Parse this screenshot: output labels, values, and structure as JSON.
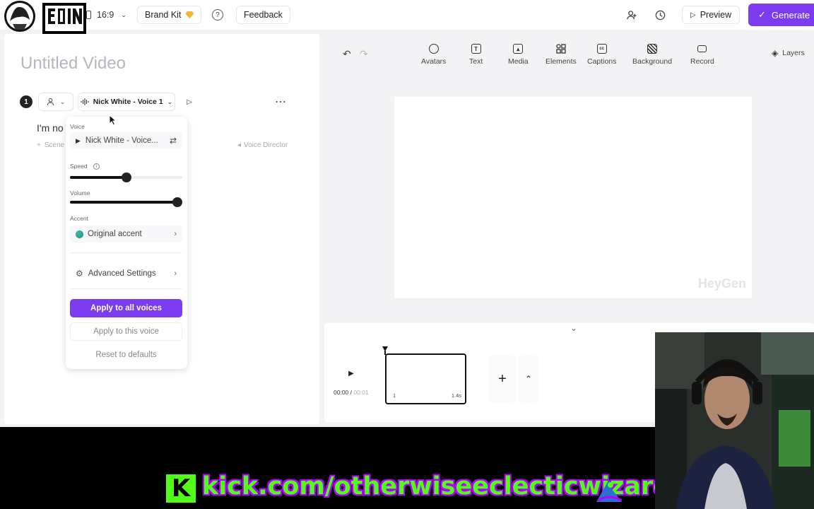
{
  "topbar": {
    "aspect_ratio": "16:9",
    "brand_kit_label": "Brand Kit",
    "feedback_label": "Feedback",
    "preview_label": "Preview",
    "generate_label": "Generate"
  },
  "editor": {
    "title": "Untitled Video",
    "scene_number": "1",
    "voice_select_label": "Nick White - Voice 1",
    "script_text": "I'm no",
    "scene_add_label": "Scene",
    "voice_director_label": "Voice Director"
  },
  "voice_popup": {
    "voice_label": "Voice",
    "voice_value": "Nick White - Voice...",
    "speed_label": "Speed",
    "speed_level": 0.5,
    "volume_label": "Volume",
    "volume_level": 1.0,
    "accent_label": "Accent",
    "accent_value": "Original accent",
    "advanced_label": "Advanced Settings",
    "apply_all_label": "Apply to all voices",
    "apply_this_label": "Apply to this voice",
    "reset_label": "Reset to defaults"
  },
  "toolbar": {
    "items": [
      {
        "label": "Avatars",
        "icon": "avatar-icon"
      },
      {
        "label": "Text",
        "icon": "text-icon"
      },
      {
        "label": "Media",
        "icon": "media-icon"
      },
      {
        "label": "Elements",
        "icon": "elements-icon"
      },
      {
        "label": "Captions",
        "icon": "captions-icon"
      },
      {
        "label": "Background",
        "icon": "background-icon"
      },
      {
        "label": "Record",
        "icon": "record-icon"
      }
    ],
    "layers_label": "Layers"
  },
  "canvas": {
    "watermark": "HeyGen"
  },
  "timeline": {
    "time_current": "00:00",
    "time_total": "00:01",
    "clip_index": "1",
    "clip_duration": "1.4s"
  },
  "overlay": {
    "kick_logo": "K",
    "kick_url": "kick.com/otherwiseeclecticwizard"
  },
  "colors": {
    "accent": "#7b3cf0",
    "kick_green": "#53fc18",
    "kick_outline": "#b400ff"
  }
}
